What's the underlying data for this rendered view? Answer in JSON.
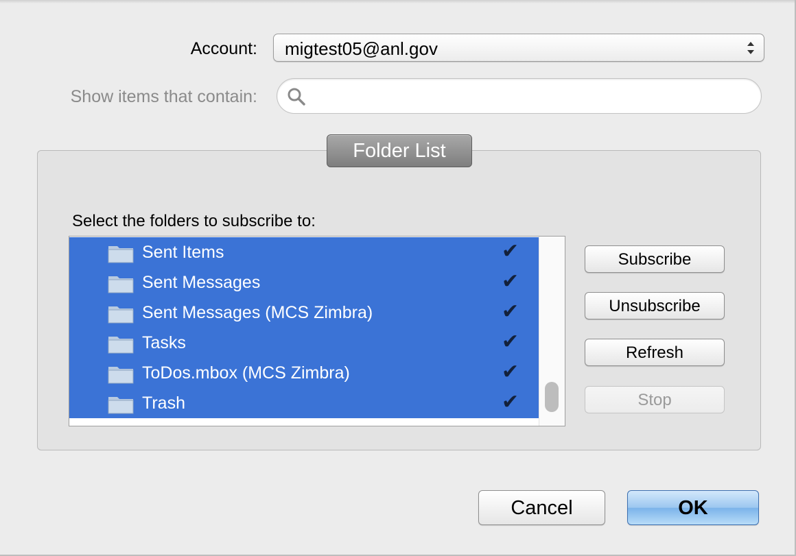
{
  "account": {
    "label": "Account:",
    "value": "migtest05@anl.gov",
    "icon": "updown-arrows-icon"
  },
  "filter": {
    "label": "Show items that contain:",
    "value": "",
    "icon": "search-icon"
  },
  "group": {
    "title": "Folder List",
    "instruction": "Select the folders to subscribe to:"
  },
  "folders": [
    {
      "name": "Sent Items",
      "subscribed": true,
      "check": "✔",
      "icon": "folder-icon"
    },
    {
      "name": "Sent Messages",
      "subscribed": true,
      "check": "✔",
      "icon": "folder-icon"
    },
    {
      "name": "Sent Messages (MCS Zimbra)",
      "subscribed": true,
      "check": "✔",
      "icon": "folder-icon"
    },
    {
      "name": "Tasks",
      "subscribed": true,
      "check": "✔",
      "icon": "folder-icon"
    },
    {
      "name": "ToDos.mbox (MCS Zimbra)",
      "subscribed": true,
      "check": "✔",
      "icon": "folder-icon"
    },
    {
      "name": "Trash",
      "subscribed": true,
      "check": "✔",
      "icon": "folder-icon"
    }
  ],
  "side_buttons": {
    "subscribe": "Subscribe",
    "unsubscribe": "Unsubscribe",
    "refresh": "Refresh",
    "stop": "Stop"
  },
  "footer": {
    "cancel": "Cancel",
    "ok": "OK"
  },
  "colors": {
    "selection": "#3b73d6",
    "ok_button": "#7bb3ea"
  }
}
